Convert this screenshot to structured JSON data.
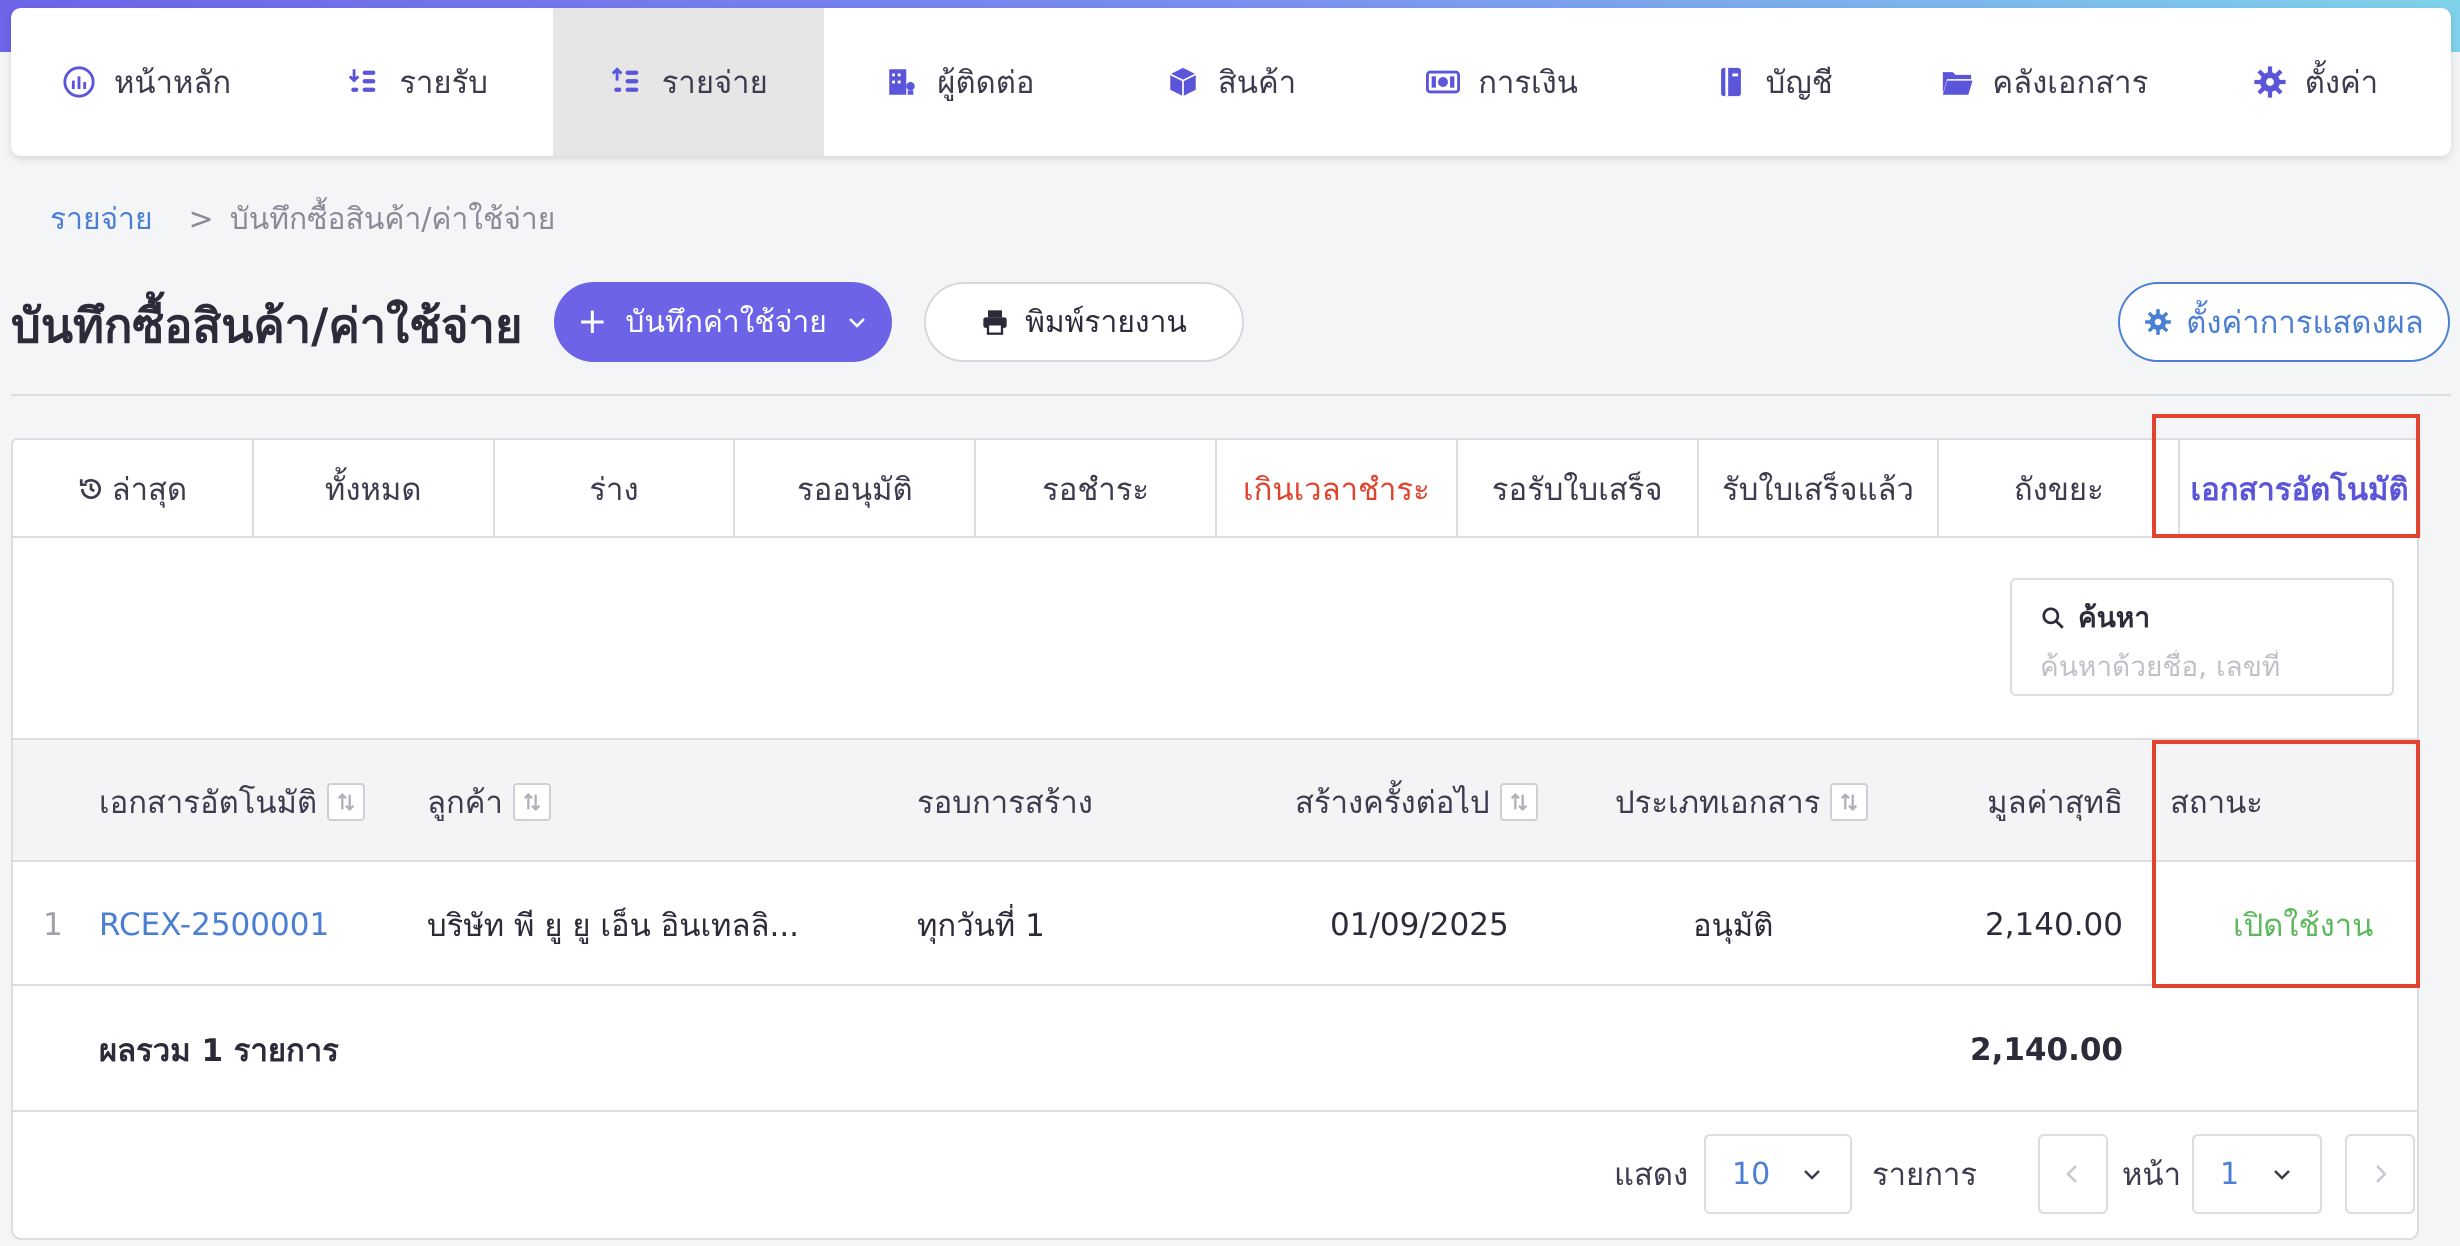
{
  "nav": {
    "items": [
      {
        "label": "หน้าหลัก",
        "icon": "dashboard-icon"
      },
      {
        "label": "รายรับ",
        "icon": "income-coins-icon"
      },
      {
        "label": "รายจ่าย",
        "icon": "expense-coins-icon",
        "active": true
      },
      {
        "label": "ผู้ติดต่อ",
        "icon": "building-icon"
      },
      {
        "label": "สินค้า",
        "icon": "box-icon"
      },
      {
        "label": "การเงิน",
        "icon": "money-icon"
      },
      {
        "label": "บัญชี",
        "icon": "book-icon"
      },
      {
        "label": "คลังเอกสาร",
        "icon": "folder-icon"
      },
      {
        "label": "ตั้งค่า",
        "icon": "gear-icon"
      }
    ]
  },
  "breadcrumb": {
    "root": "รายจ่าย",
    "separator": ">",
    "current": "บันทึกซื้อสินค้า/ค่าใช้จ่าย"
  },
  "page": {
    "title": "บันทึกซื้อสินค้า/ค่าใช้จ่าย",
    "add_button": "บันทึกค่าใช้จ่าย",
    "print_button": "พิมพ์รายงาน",
    "display_settings_button": "ตั้งค่าการแสดงผล"
  },
  "tabs": [
    {
      "label": "ล่าสุด"
    },
    {
      "label": "ทั้งหมด"
    },
    {
      "label": "ร่าง"
    },
    {
      "label": "รออนุมัติ"
    },
    {
      "label": "รอชำระ"
    },
    {
      "label": "เกินเวลาชำระ"
    },
    {
      "label": "รอรับใบเสร็จ"
    },
    {
      "label": "รับใบเสร็จแล้ว"
    },
    {
      "label": "ถังขยะ"
    },
    {
      "label": "เอกสารอัตโนมัติ",
      "active": true
    }
  ],
  "search": {
    "label": "ค้นหา",
    "placeholder": "ค้นหาด้วยชื่อ, เลขที่"
  },
  "table": {
    "headers": {
      "doc": "เอกสารอัตโนมัติ",
      "customer": "ลูกค้า",
      "cycle": "รอบการสร้าง",
      "next": "สร้างครั้งต่อไป",
      "type": "ประเภทเอกสาร",
      "net": "มูลค่าสุทธิ",
      "status": "สถานะ"
    },
    "rows": [
      {
        "index": "1",
        "doc": "RCEX-2500001",
        "customer": "บริษัท พี ยู ยู เอ็น อินเทลลิ...",
        "cycle": "ทุกวันที่ 1",
        "next": "01/09/2025",
        "type": "อนุมัติ",
        "net": "2,140.00",
        "status": "เปิดใช้งาน"
      }
    ],
    "total_label": "ผลรวม 1 รายการ",
    "total_value": "2,140.00"
  },
  "pagination": {
    "show_label": "แสดง",
    "page_size": "10",
    "items_label": "รายการ",
    "page_label": "หน้า",
    "page": "1"
  },
  "colors": {
    "accent": "#6c63e6",
    "link": "#4a7fd4",
    "overdue": "#e0442f",
    "active_status": "#5cb85c",
    "highlight": "#e0442f"
  }
}
